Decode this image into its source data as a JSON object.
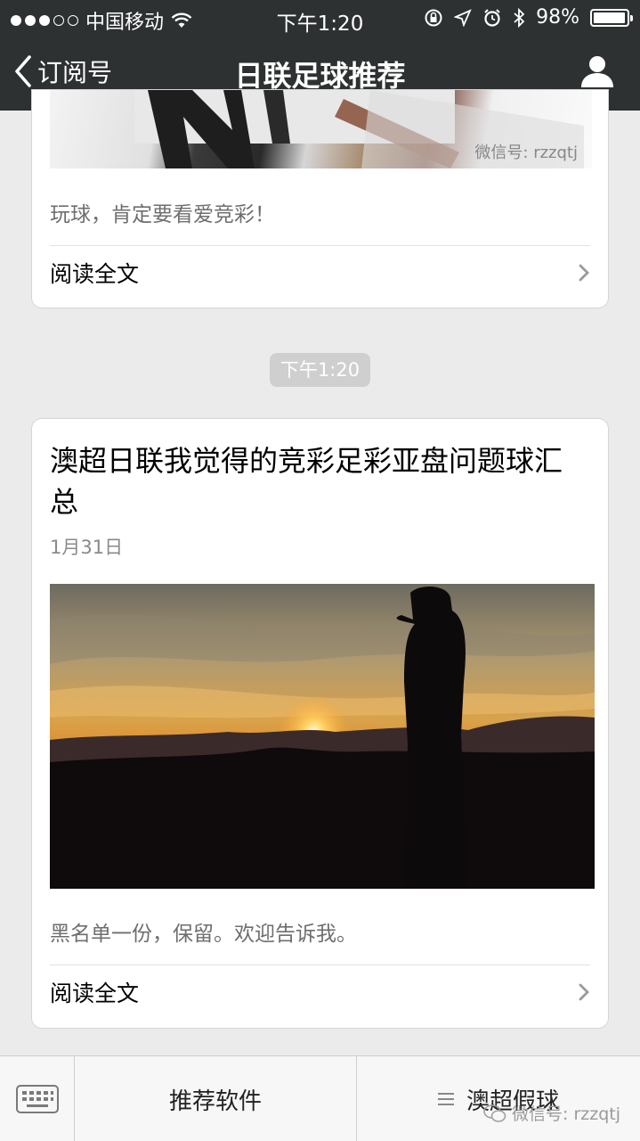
{
  "status_bar": {
    "carrier": "中国移动",
    "time": "下午1:20",
    "battery_text": "98%",
    "battery_level": 0.98,
    "signal_bars_filled": 3,
    "signal_bars_total": 5
  },
  "nav": {
    "back_label": "订阅号",
    "title": "日联足球推荐"
  },
  "card1": {
    "watermark": "微信号: rzzqtj",
    "digest": "玩球，肯定要看爱竞彩！",
    "read_more": "阅读全文"
  },
  "timestamp": "下午1:20",
  "card2": {
    "title": "澳超日联我觉得的竞彩足彩亚盘问题球汇总",
    "date": "1月31日",
    "digest": "黑名单一份，保留。欢迎告诉我。",
    "read_more": "阅读全文"
  },
  "bottom_bar": {
    "menu_1": "推荐软件",
    "menu_2": "澳超假球",
    "watermark": "微信号: rzzqtj"
  },
  "colors": {
    "nav_bg": "#2e3132",
    "page_bg": "#ebebeb",
    "pill_bg": "#cfcfcf"
  },
  "icons": {
    "back": "chevron-left-icon",
    "profile": "person-icon",
    "keyboard": "keyboard-icon",
    "menu": "hamburger-icon",
    "wechat": "wechat-icon"
  }
}
